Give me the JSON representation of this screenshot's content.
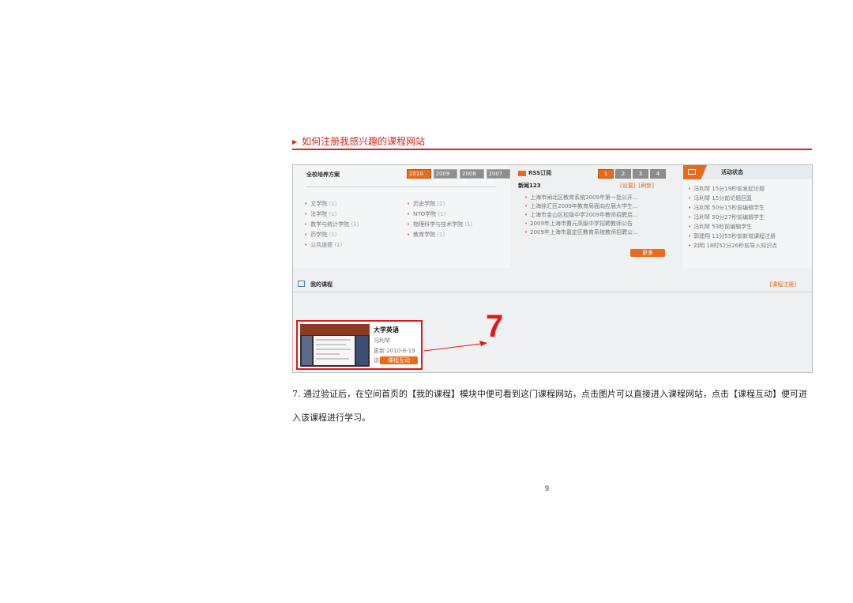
{
  "heading": "如何注册我感兴趣的课程网站",
  "screenshot": {
    "training_plan": {
      "title": "全校培养方案",
      "years": [
        "2010年",
        "2009年",
        "2008年",
        "2007年"
      ],
      "active_year": "2010年",
      "colleges": [
        {
          "name": "文学院",
          "count": "(1)"
        },
        {
          "name": "历史学院",
          "count": "(2)"
        },
        {
          "name": "法学院",
          "count": "(1)"
        },
        {
          "name": "NTO学院",
          "count": "(1)"
        },
        {
          "name": "数学与统计学院",
          "count": "(1)"
        },
        {
          "name": "物理科学与技术学院",
          "count": "(1)"
        },
        {
          "name": "药学院",
          "count": "(1)"
        },
        {
          "name": "教育学院",
          "count": "(1)"
        },
        {
          "name": "公共道德",
          "count": "(1)"
        }
      ]
    },
    "rss": {
      "title": "RSS订阅",
      "pages": [
        "1",
        "2",
        "3",
        "4"
      ],
      "feed_name": "新闻123",
      "settings_label": "[设置]",
      "refresh_label": "[刷新]",
      "items": [
        "上海市闸北区教育系统2009年第一批公开...",
        "上海徐汇区2009年教育局面向应届大学生...",
        "上海市金山区松隐中学2009年教师招聘启...",
        "2009年上海市曹元高级中学招聘教师公告",
        "2009年上海市嘉定区教育系统教师招聘公..."
      ],
      "more_label": "更多"
    },
    "activity": {
      "title": "活动状态",
      "items": [
        "冯利琴 15分19秒前发起论题",
        "冯利琴 15分前论题回复",
        "冯利琴 50分15秒前编辑学生",
        "冯利琴 50分27秒前编辑学生",
        "冯利琴 53秒前编辑学生",
        "郭建翔 11分55秒前新增课程注册",
        "刘明 18时52分26秒前导入知识点"
      ]
    },
    "my_courses": {
      "title": "我的课程",
      "register_label": "[课程注册]",
      "course": {
        "name": "大学英语",
        "teacher": "冯利琴",
        "updated": "更新:2010-8-19",
        "visits": "访问:9",
        "interact_label": "课程互动"
      }
    },
    "step_number": "7"
  },
  "caption": "7. 通过验证后，在空间首页的【我的课程】模块中便可看到这门课程网站，点击图片可以直接进入课程网站，点击【课程互动】便可进入该课程进行学习。",
  "page_number": "9",
  "colors": {
    "accent": "#e86a1c",
    "highlight": "#e01818",
    "heading": "#d9251c"
  }
}
